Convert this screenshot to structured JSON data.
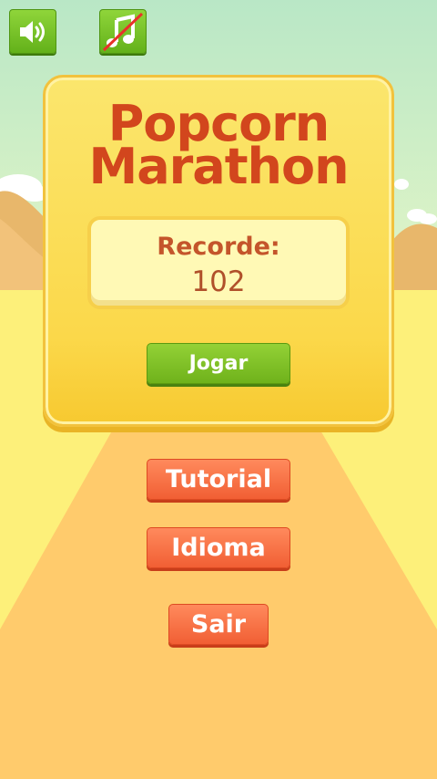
{
  "game": {
    "title_line1": "Popcorn",
    "title_line2": "Marathon"
  },
  "toolbar": {
    "sound_icon": "speaker-icon",
    "music_icon": "music-note-muted-icon"
  },
  "record": {
    "label": "Recorde:",
    "value": "102"
  },
  "menu": {
    "play_label": "Jogar",
    "tutorial_label": "Tutorial",
    "language_label": "Idioma",
    "exit_label": "Sair"
  },
  "colors": {
    "sky": "#cdeec6",
    "sand": "#fdf07a",
    "road": "#ffcb6c",
    "title": "#d2461d",
    "green_button": "#7cc126",
    "orange_button": "#f5714a"
  }
}
